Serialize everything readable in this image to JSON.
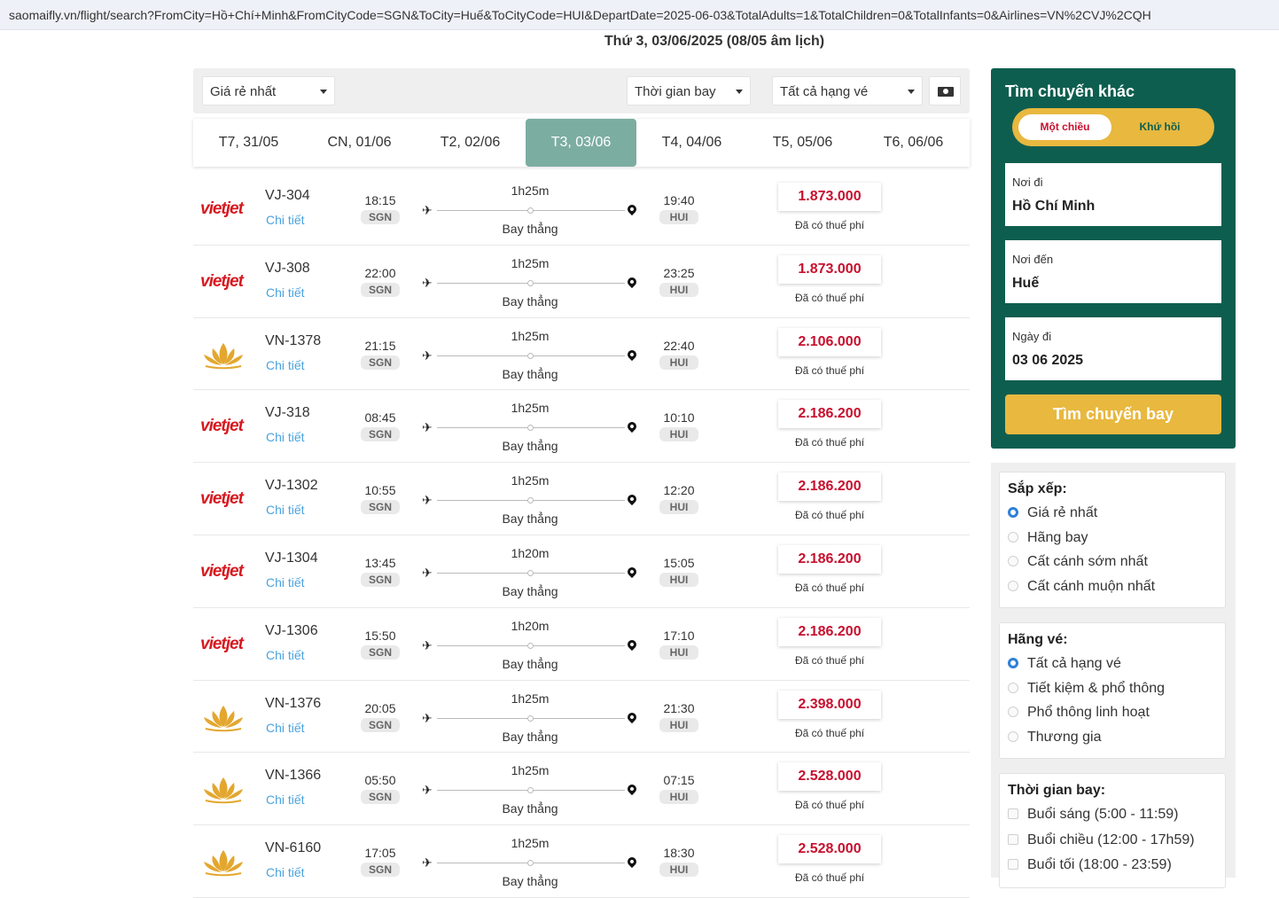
{
  "browser": {
    "url": "saomaifly.vn/flight/search?FromCity=Hồ+Chí+Minh&FromCityCode=SGN&ToCity=Huế&ToCityCode=HUI&DepartDate=2025-06-03&TotalAdults=1&TotalChildren=0&TotalInfants=0&Airlines=VN%2CVJ%2CQH"
  },
  "header": {
    "date_title": "Thứ 3, 03/06/2025 (08/05 âm lịch)"
  },
  "toolbar": {
    "sort_select": "Giá rẻ nhất",
    "time_select": "Thời gian bay",
    "class_select": "Tất cả hạng vé",
    "money_icon": "money-bill-icon"
  },
  "dates": [
    "T7, 31/05",
    "CN, 01/06",
    "T2, 02/06",
    "T3, 03/06",
    "T4, 04/06",
    "T5, 05/06",
    "T6, 06/06"
  ],
  "active_date": "T3, 03/06",
  "flights": [
    {
      "airline": "vietjet",
      "logo_text": "vietjet",
      "code": "VJ-304",
      "detail": "Chi tiết",
      "dep_time": "18:15",
      "dep_apt": "SGN",
      "duration": "1h25m",
      "stop": "Bay thẳng",
      "arr_time": "19:40",
      "arr_apt": "HUI",
      "price": "1.873.000",
      "tax": "Đã có thuế phí"
    },
    {
      "airline": "vietjet",
      "logo_text": "vietjet",
      "code": "VJ-308",
      "detail": "Chi tiết",
      "dep_time": "22:00",
      "dep_apt": "SGN",
      "duration": "1h25m",
      "stop": "Bay thẳng",
      "arr_time": "23:25",
      "arr_apt": "HUI",
      "price": "1.873.000",
      "tax": "Đã có thuế phí"
    },
    {
      "airline": "vietnam-airlines",
      "logo_text": "",
      "code": "VN-1378",
      "detail": "Chi tiết",
      "dep_time": "21:15",
      "dep_apt": "SGN",
      "duration": "1h25m",
      "stop": "Bay thẳng",
      "arr_time": "22:40",
      "arr_apt": "HUI",
      "price": "2.106.000",
      "tax": "Đã có thuế phí"
    },
    {
      "airline": "vietjet",
      "logo_text": "vietjet",
      "code": "VJ-318",
      "detail": "Chi tiết",
      "dep_time": "08:45",
      "dep_apt": "SGN",
      "duration": "1h25m",
      "stop": "Bay thẳng",
      "arr_time": "10:10",
      "arr_apt": "HUI",
      "price": "2.186.200",
      "tax": "Đã có thuế phí"
    },
    {
      "airline": "vietjet",
      "logo_text": "vietjet",
      "code": "VJ-1302",
      "detail": "Chi tiết",
      "dep_time": "10:55",
      "dep_apt": "SGN",
      "duration": "1h25m",
      "stop": "Bay thẳng",
      "arr_time": "12:20",
      "arr_apt": "HUI",
      "price": "2.186.200",
      "tax": "Đã có thuế phí"
    },
    {
      "airline": "vietjet",
      "logo_text": "vietjet",
      "code": "VJ-1304",
      "detail": "Chi tiết",
      "dep_time": "13:45",
      "dep_apt": "SGN",
      "duration": "1h20m",
      "stop": "Bay thẳng",
      "arr_time": "15:05",
      "arr_apt": "HUI",
      "price": "2.186.200",
      "tax": "Đã có thuế phí"
    },
    {
      "airline": "vietjet",
      "logo_text": "vietjet",
      "code": "VJ-1306",
      "detail": "Chi tiết",
      "dep_time": "15:50",
      "dep_apt": "SGN",
      "duration": "1h20m",
      "stop": "Bay thẳng",
      "arr_time": "17:10",
      "arr_apt": "HUI",
      "price": "2.186.200",
      "tax": "Đã có thuế phí"
    },
    {
      "airline": "vietnam-airlines",
      "logo_text": "",
      "code": "VN-1376",
      "detail": "Chi tiết",
      "dep_time": "20:05",
      "dep_apt": "SGN",
      "duration": "1h25m",
      "stop": "Bay thẳng",
      "arr_time": "21:30",
      "arr_apt": "HUI",
      "price": "2.398.000",
      "tax": "Đã có thuế phí"
    },
    {
      "airline": "vietnam-airlines",
      "logo_text": "",
      "code": "VN-1366",
      "detail": "Chi tiết",
      "dep_time": "05:50",
      "dep_apt": "SGN",
      "duration": "1h25m",
      "stop": "Bay thẳng",
      "arr_time": "07:15",
      "arr_apt": "HUI",
      "price": "2.528.000",
      "tax": "Đã có thuế phí"
    },
    {
      "airline": "vietnam-airlines",
      "logo_text": "",
      "code": "VN-6160",
      "detail": "Chi tiết",
      "dep_time": "17:05",
      "dep_apt": "SGN",
      "duration": "1h25m",
      "stop": "Bay thẳng",
      "arr_time": "18:30",
      "arr_apt": "HUI",
      "price": "2.528.000",
      "tax": "Đã có thuế phí"
    }
  ],
  "search_panel": {
    "title": "Tìm chuyến khác",
    "one_way": "Một chiều",
    "round_trip": "Khứ hồi",
    "from_label": "Nơi đi",
    "from_value": "Hồ Chí Minh",
    "to_label": "Nơi đến",
    "to_value": "Huế",
    "date_label": "Ngày đi",
    "date_value": "03 06 2025",
    "search_button": "Tìm chuyến bay"
  },
  "sort_filter": {
    "title": "Sắp xếp:",
    "options": [
      "Giá rẻ nhất",
      "Hãng bay",
      "Cất cánh sớm nhất",
      "Cất cánh muộn nhất"
    ],
    "selected": "Giá rẻ nhất"
  },
  "class_filter": {
    "title": "Hãng vé:",
    "options": [
      "Tất cả hạng vé",
      "Tiết kiệm & phổ thông",
      "Phổ thông linh hoạt",
      "Thương gia"
    ],
    "selected": "Tất cả hạng vé"
  },
  "time_filter": {
    "title": "Thời gian bay:",
    "options": [
      "Buổi sáng (5:00 - 11:59)",
      "Buổi chiều (12:00 - 17h59)",
      "Buổi tối (18:00 - 23:59)"
    ]
  },
  "colors": {
    "brand_green": "#0e5e4f",
    "accent_gold": "#e8b83f",
    "price_red": "#c8102e",
    "active_tab": "#7cada1",
    "link_blue": "#4aa3df"
  }
}
